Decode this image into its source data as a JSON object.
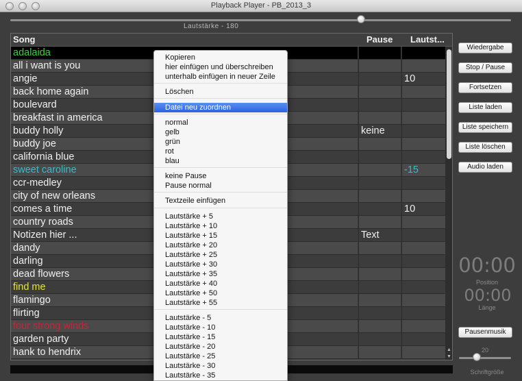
{
  "window": {
    "title": "Playback Player  -  PB_2013_3"
  },
  "volume": {
    "label": "Lautstärke -  180"
  },
  "table": {
    "headers": {
      "song": "Song",
      "pause": "Pause",
      "laut": "Lautst..."
    },
    "rows": [
      {
        "song": "adalaida",
        "pause": "",
        "laut": "",
        "color": "#3fcf3f",
        "selected": true
      },
      {
        "song": "all i want is you",
        "pause": "",
        "laut": "",
        "color": "#f0f0f0"
      },
      {
        "song": "angie",
        "pause": "",
        "laut": "10",
        "color": "#f0f0f0"
      },
      {
        "song": "back home again",
        "pause": "",
        "laut": "",
        "color": "#f0f0f0"
      },
      {
        "song": "boulevard",
        "pause": "",
        "laut": "",
        "color": "#f0f0f0"
      },
      {
        "song": "breakfast in america",
        "pause": "",
        "laut": "",
        "color": "#f0f0f0"
      },
      {
        "song": "buddy holly",
        "pause": "keine",
        "laut": "",
        "color": "#f0f0f0"
      },
      {
        "song": "buddy joe",
        "pause": "",
        "laut": "",
        "color": "#f0f0f0"
      },
      {
        "song": "california blue",
        "pause": "",
        "laut": "",
        "color": "#f0f0f0"
      },
      {
        "song": "sweet caroline",
        "pause": "",
        "laut": "-15",
        "color": "#3cb9c9"
      },
      {
        "song": "ccr-medley",
        "pause": "",
        "laut": "",
        "color": "#f0f0f0"
      },
      {
        "song": "city of new orleans",
        "pause": "",
        "laut": "",
        "color": "#f0f0f0"
      },
      {
        "song": "comes a time",
        "pause": "",
        "laut": "10",
        "color": "#f0f0f0"
      },
      {
        "song": "country roads",
        "pause": "",
        "laut": "",
        "color": "#f0f0f0"
      },
      {
        "song": "Notizen hier ...",
        "pause": "Text",
        "laut": "",
        "color": "#f0f0f0"
      },
      {
        "song": "dandy",
        "pause": "",
        "laut": "",
        "color": "#f0f0f0"
      },
      {
        "song": "darling",
        "pause": "",
        "laut": "",
        "color": "#f0f0f0"
      },
      {
        "song": "dead flowers",
        "pause": "",
        "laut": "",
        "color": "#f0f0f0"
      },
      {
        "song": "find me",
        "pause": "",
        "laut": "",
        "color": "#e4e43a"
      },
      {
        "song": "flamingo",
        "pause": "",
        "laut": "",
        "color": "#f0f0f0"
      },
      {
        "song": "flirting",
        "pause": "",
        "laut": "",
        "color": "#f0f0f0"
      },
      {
        "song": "four strong winds",
        "pause": "",
        "laut": "",
        "color": "#c0283a"
      },
      {
        "song": "garden party",
        "pause": "",
        "laut": "",
        "color": "#f0f0f0"
      },
      {
        "song": "hank to hendrix",
        "pause": "",
        "laut": "",
        "color": "#f0f0f0"
      }
    ]
  },
  "buttons": {
    "wiedergabe": "Wiedergabe",
    "stop": "Stop / Pause",
    "fortsetzen": "Fortsetzen",
    "liste_laden": "Liste laden",
    "liste_speichern": "Liste speichern",
    "liste_loeschen": "Liste löschen",
    "audio_laden": "Audio laden",
    "pausenmusik": "Pausenmusik"
  },
  "timer": {
    "position_time": "00:00",
    "position_label": "Position",
    "length_time": "00:00",
    "length_label": "Länge"
  },
  "font_size": {
    "value": "20",
    "label": "Schriftgröße"
  },
  "context_menu": {
    "items": [
      "Kopieren",
      "hier einfügen und überschreiben",
      "unterhalb einfügen in neuer Zeile",
      "Löschen",
      "Datei neu zuordnen",
      "normal",
      "gelb",
      "grün",
      "rot",
      "blau",
      "keine Pause",
      "Pause normal",
      "Textzeile einfügen",
      "Lautstärke + 5",
      "Lautstärke + 10",
      "Lautstärke + 15",
      "Lautstärke + 20",
      "Lautstärke + 25",
      "Lautstärke + 30",
      "Lautstärke + 35",
      "Lautstärke + 40",
      "Lautstärke + 50",
      "Lautstärke + 55",
      "Lautstärke - 5",
      "Lautstärke - 10",
      "Lautstärke - 15",
      "Lautstärke - 20",
      "Lautstärke - 25",
      "Lautstärke - 30",
      "Lautstärke - 35"
    ],
    "highlighted_index": 4
  }
}
